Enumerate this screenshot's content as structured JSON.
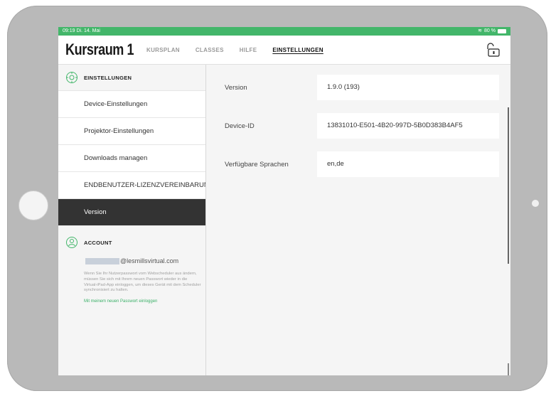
{
  "status": {
    "time_date": "09:19  Di. 14. Mai",
    "battery": "80 %"
  },
  "app": {
    "title": "Kursraum 1"
  },
  "nav": [
    {
      "label": "KURSPLAN"
    },
    {
      "label": "CLASSES"
    },
    {
      "label": "HILFE"
    },
    {
      "label": "EINSTELLUNGEN"
    }
  ],
  "sidebar": {
    "header": "EINSTELLUNGEN",
    "items": [
      {
        "label": "Device-Einstellungen"
      },
      {
        "label": "Projektor-Einstellungen"
      },
      {
        "label": "Downloads managen"
      },
      {
        "label": "ENDBENUTZER-LIZENZVEREINBARUNG"
      },
      {
        "label": "Version"
      }
    ],
    "account": {
      "header": "ACCOUNT",
      "email": "@lesmillsvirtual.com",
      "note": "Wenn Sie Ihr Nutzerpasswort vom Webscheduler aus ändern, müssen Sie sich mit Ihrem neuen Passwort wieder in die Virtual-iPad-App einloggen, um dieses Gerät mit dem Scheduler synchronisiert zu halten.",
      "relogin_link": "Mit meinem neuen Passwort einloggen"
    }
  },
  "content": {
    "rows": [
      {
        "label": "Version",
        "value": "1.9.0 (193)"
      },
      {
        "label": "Device-ID",
        "value": "13831010-E501-4B20-997D-5B0D383B4AF5"
      },
      {
        "label": "Verfügbare Sprachen",
        "value": "en,de"
      }
    ]
  },
  "colors": {
    "accent": "#43b66a",
    "active_item": "#333333"
  }
}
